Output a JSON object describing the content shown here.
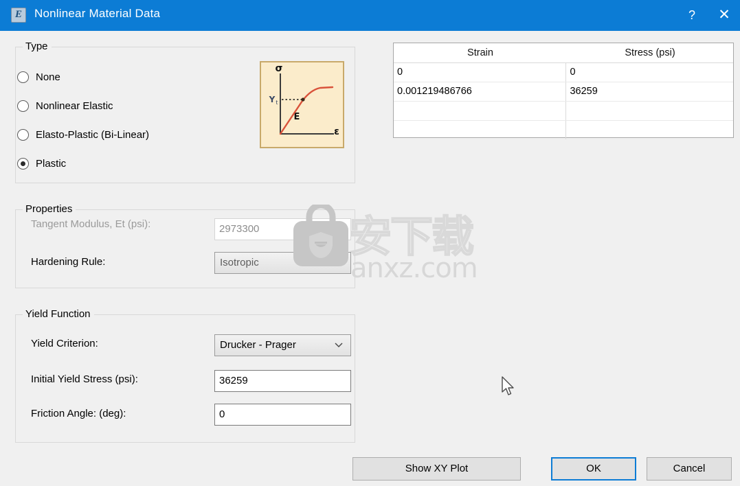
{
  "window": {
    "title": "Nonlinear Material Data",
    "icon": "app-icon",
    "help_label": "?",
    "close_label": "✕",
    "titlebar_color": "#0c7cd5"
  },
  "type_group": {
    "legend": "Type",
    "options": [
      {
        "label": "None",
        "selected": false
      },
      {
        "label": "Nonlinear Elastic",
        "selected": false
      },
      {
        "label": "Elasto-Plastic (Bi-Linear)",
        "selected": false
      },
      {
        "label": "Plastic",
        "selected": true
      }
    ],
    "thumbnail": {
      "name": "stress-strain-curve-thumbnail",
      "y_axis_symbol": "σ",
      "x_axis_symbol": "ε",
      "yield_label": "Yt",
      "modulus_label": "E",
      "background_color": "#fbeccb",
      "border_color": "#c8a96a",
      "curve_color": "#d9523a"
    }
  },
  "data_table": {
    "headers": [
      "Strain",
      "Stress (psi)"
    ],
    "rows": [
      [
        "0",
        "0"
      ],
      [
        "0.001219486766",
        "36259"
      ],
      [
        "",
        ""
      ],
      [
        "",
        ""
      ]
    ]
  },
  "properties_group": {
    "legend": "Properties",
    "tangent_modulus": {
      "label": "Tangent Modulus, Et (psi):",
      "value": "2973300",
      "disabled": true
    },
    "hardening_rule": {
      "label": "Hardening Rule:",
      "value": "Isotropic",
      "disabled": true
    }
  },
  "yield_group": {
    "legend": "Yield Function",
    "yield_criterion": {
      "label": "Yield Criterion:",
      "value": "Drucker - Prager"
    },
    "initial_yield_stress": {
      "label": "Initial Yield Stress (psi):",
      "value": "36259"
    },
    "friction_angle": {
      "label": "Friction Angle: (deg):",
      "value": "0"
    }
  },
  "buttons": {
    "show_xy_plot": "Show XY Plot",
    "ok": "OK",
    "cancel": "Cancel"
  },
  "watermark": {
    "cn_text": "安下载",
    "url_text": "anxz.com",
    "color": "#d9d9d9"
  }
}
